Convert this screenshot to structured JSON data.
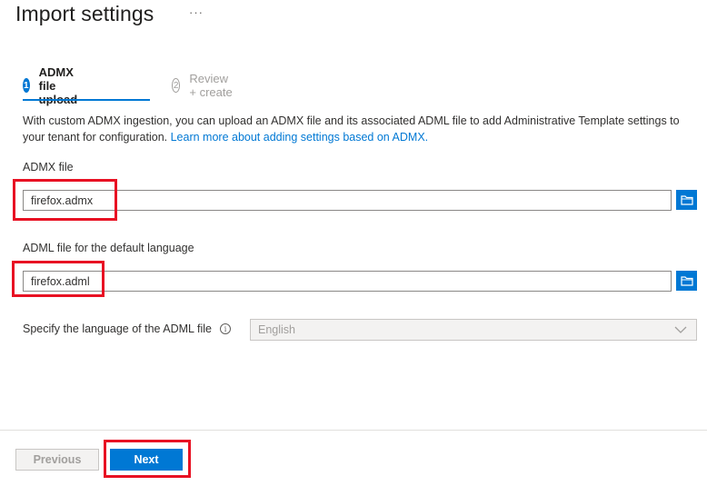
{
  "header": {
    "title": "Import settings",
    "more": "···"
  },
  "steps": [
    {
      "number": "1",
      "label": "ADMX file upload"
    },
    {
      "number": "2",
      "label": "Review + create"
    }
  ],
  "description": {
    "text": "With custom ADMX ingestion, you can upload an ADMX file and its associated ADML file to add Administrative Template settings to your tenant for configuration. ",
    "link": "Learn more about adding settings based on ADMX."
  },
  "admx": {
    "label": "ADMX file",
    "value": "firefox.admx"
  },
  "adml": {
    "label": "ADML file for the default language",
    "value": "firefox.adml"
  },
  "language": {
    "label": "Specify the language of the ADML file",
    "value": "English"
  },
  "footer": {
    "previous": "Previous",
    "next": "Next"
  },
  "colors": {
    "accent": "#0078d4",
    "highlight": "#e81123"
  }
}
